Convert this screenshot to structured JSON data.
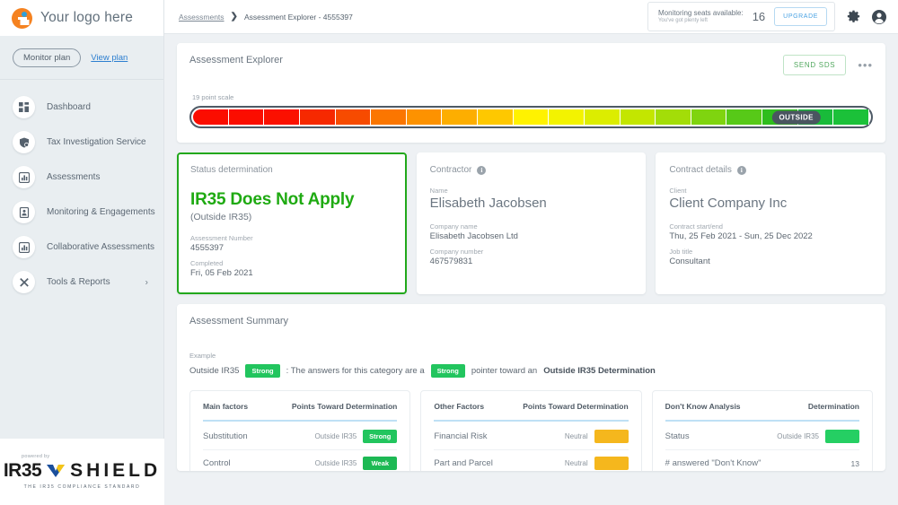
{
  "sidebar": {
    "logo_text": "Your logo here",
    "plan_pill": "Monitor plan",
    "plan_link": "View plan",
    "nav_items": [
      {
        "label": "Dashboard",
        "icon": "dashboard-icon"
      },
      {
        "label": "Tax Investigation Service",
        "icon": "shield-icon"
      },
      {
        "label": "Assessments",
        "icon": "bar-chart-icon"
      },
      {
        "label": "Monitoring & Engagements",
        "icon": "document-person-icon"
      },
      {
        "label": "Collaborative Assessments",
        "icon": "bar-chart-icon"
      },
      {
        "label": "Tools & Reports",
        "icon": "tools-icon",
        "chevron": "›"
      }
    ],
    "footer": {
      "powered_by": "powered by",
      "brand_left": "IR35",
      "brand_right": "SHIELD",
      "tagline": "THE IR35 COMPLIANCE STANDARD"
    }
  },
  "topbar": {
    "breadcrumb": [
      "Assessments",
      "Assessment Explorer - 4555397"
    ],
    "breadcrumb_separator": "❯",
    "seats_label": "Monitoring seats available:",
    "seats_sub": "You've got plenty left",
    "seats_count": "16",
    "upgrade_label": "UPGRADE",
    "gear_icon": "gear-icon",
    "account_icon": "account-icon"
  },
  "explorer": {
    "title": "Assessment Explorer",
    "send_sds_label": "SEND SDS",
    "more_label": "•••",
    "scale_label": "19 point scale",
    "marker_label": "OUTSIDE",
    "marker_position_percent": 89,
    "scale_points": 19,
    "scale_colors": [
      "#fb0d00",
      "#fb0d00",
      "#fb1000",
      "#f62900",
      "#f74b00",
      "#fb7600",
      "#fd9200",
      "#fdae00",
      "#fec800",
      "#fff200",
      "#f3f300",
      "#dced00",
      "#c3e600",
      "#a3dd08",
      "#7fd40f",
      "#57c918",
      "#2ebd1c",
      "#19bb3a",
      "#1bc139"
    ]
  },
  "status_card": {
    "title": "Status determination",
    "headline": "IR35 Does Not Apply",
    "subhead": "(Outside IR35)",
    "fields": [
      {
        "label": "Assessment Number",
        "value": "4555397"
      },
      {
        "label": "Completed",
        "value": "Fri, 05 Feb 2021"
      }
    ]
  },
  "contractor_card": {
    "title": "Contractor",
    "info_icon": "info-icon",
    "name_label": "Name",
    "name_value": "Elisabeth Jacobsen",
    "fields": [
      {
        "label": "Company name",
        "value": "Elisabeth Jacobsen Ltd"
      },
      {
        "label": "Company number",
        "value": "467579831"
      }
    ]
  },
  "contract_card": {
    "title": "Contract details",
    "info_icon": "info-icon",
    "client_label": "Client",
    "client_value": "Client Company Inc",
    "fields": [
      {
        "label": "Contract start/end",
        "value": "Thu, 25 Feb 2021 - Sun, 25 Dec 2022"
      },
      {
        "label": "Job title",
        "value": "Consultant"
      }
    ]
  },
  "summary": {
    "title": "Assessment Summary",
    "example_label": "Example",
    "example_prefix": "Outside IR35",
    "example_badge_1": "Strong",
    "example_mid": ": The answers for this category are a",
    "example_badge_2": "Strong",
    "example_suffix": "pointer toward an",
    "example_bold": "Outside IR35 Determination"
  },
  "tables": [
    {
      "col_left": "Main factors",
      "col_right": "Points Toward Determination",
      "rows": [
        {
          "name": "Substitution",
          "value": "Outside IR35",
          "badge": "Strong",
          "badge_color": "#22c55e"
        },
        {
          "name": "Control",
          "value": "Outside IR35",
          "badge": "Weak",
          "badge_color": "#1db954"
        }
      ]
    },
    {
      "col_left": "Other Factors",
      "col_right": "Points Toward Determination",
      "rows": [
        {
          "name": "Financial Risk",
          "value": "Neutral",
          "badge": "",
          "badge_color": "#f5b71d"
        },
        {
          "name": "Part and Parcel",
          "value": "Neutral",
          "badge": "",
          "badge_color": "#f5b71d"
        }
      ]
    },
    {
      "col_left": "Don't Know Analysis",
      "col_right": "Determination",
      "rows": [
        {
          "name": "Status",
          "value": "Outside IR35",
          "badge": "",
          "badge_color": "#25cf63"
        },
        {
          "name": "# answered \"Don't Know\"",
          "value": "",
          "badge": "",
          "count": "13"
        }
      ]
    }
  ],
  "colors": {
    "accent_green": "#22a81c",
    "link_blue": "#2d7fd0",
    "brand_orange": "#f58220",
    "page_bg": "#eef1f4",
    "sidebar_bg": "#e9eef1"
  }
}
